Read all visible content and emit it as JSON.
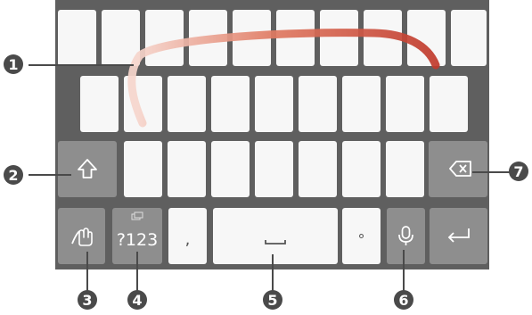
{
  "keyboard": {
    "symbols_key_label": "?123",
    "comma_key_label": ",",
    "period_key_label": "°"
  },
  "callouts": [
    "1",
    "2",
    "3",
    "4",
    "5",
    "6",
    "7"
  ],
  "colors": {
    "background": "#5f5f5f",
    "letter_key": "#f7f7f7",
    "function_key": "#8e8e8e",
    "swipe_trail": "#c0392b",
    "callout_badge": "#4a4a4a"
  },
  "icons": {
    "shift": "shift-arrow-icon",
    "gesture": "swipe-hand-icon",
    "space": "space-bar-icon",
    "voice": "microphone-icon",
    "backspace": "backspace-icon",
    "enter": "enter-arrow-icon"
  }
}
